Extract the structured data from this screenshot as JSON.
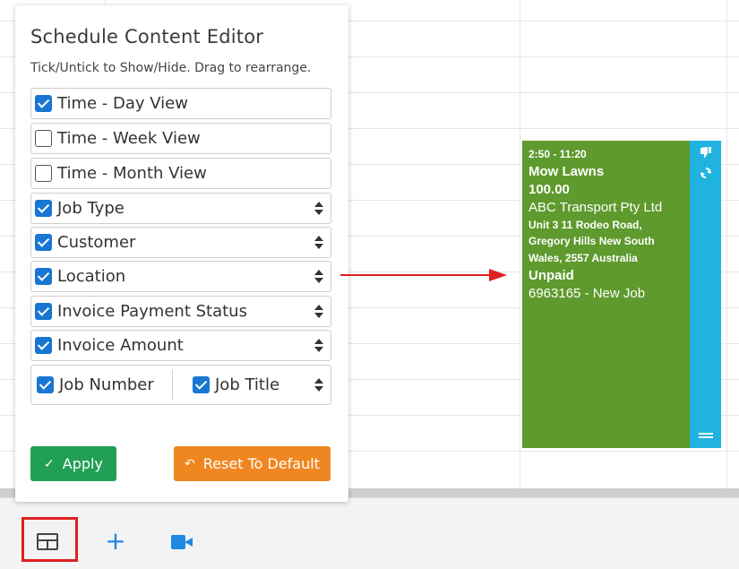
{
  "editor": {
    "title": "Schedule Content Editor",
    "subtitle": "Tick/Untick to Show/Hide. Drag to rearrange.",
    "rows": [
      {
        "label": "Time - Day View",
        "checked": true,
        "sortable": false
      },
      {
        "label": "Time - Week View",
        "checked": false,
        "sortable": false
      },
      {
        "label": "Time - Month View",
        "checked": false,
        "sortable": false
      },
      {
        "label": "Job Type",
        "checked": true,
        "sortable": true
      },
      {
        "label": "Customer",
        "checked": true,
        "sortable": true
      },
      {
        "label": "Location",
        "checked": true,
        "sortable": true
      },
      {
        "label": "Invoice Payment Status",
        "checked": true,
        "sortable": true
      },
      {
        "label": "Invoice Amount",
        "checked": true,
        "sortable": true
      }
    ],
    "split_row": {
      "left_label": "Job Number",
      "left_checked": true,
      "right_label": "Job Title",
      "right_checked": true
    },
    "apply_label": "Apply",
    "reset_label": "Reset To Default"
  },
  "job_card": {
    "time": "2:50 - 11:20",
    "job_type": "Mow Lawns",
    "amount": "100.00",
    "customer": "ABC Transport Pty Ltd",
    "address_line1": "Unit 3 11 Rodeo Road,",
    "address_line2": "Gregory Hills New South",
    "address_line3": "Wales, 2557 Australia",
    "payment_status": "Unpaid",
    "job_number_title": "6963165 - New Job"
  },
  "colors": {
    "job_card_bg": "#5e9a2d",
    "job_card_side": "#20b3e0",
    "apply": "#21a055",
    "reset": "#f0861f",
    "checkbox": "#1976d2",
    "arrow": "#e02020"
  },
  "toolbar": {
    "icons": [
      "layout-icon",
      "plus-icon",
      "video-icon"
    ]
  }
}
